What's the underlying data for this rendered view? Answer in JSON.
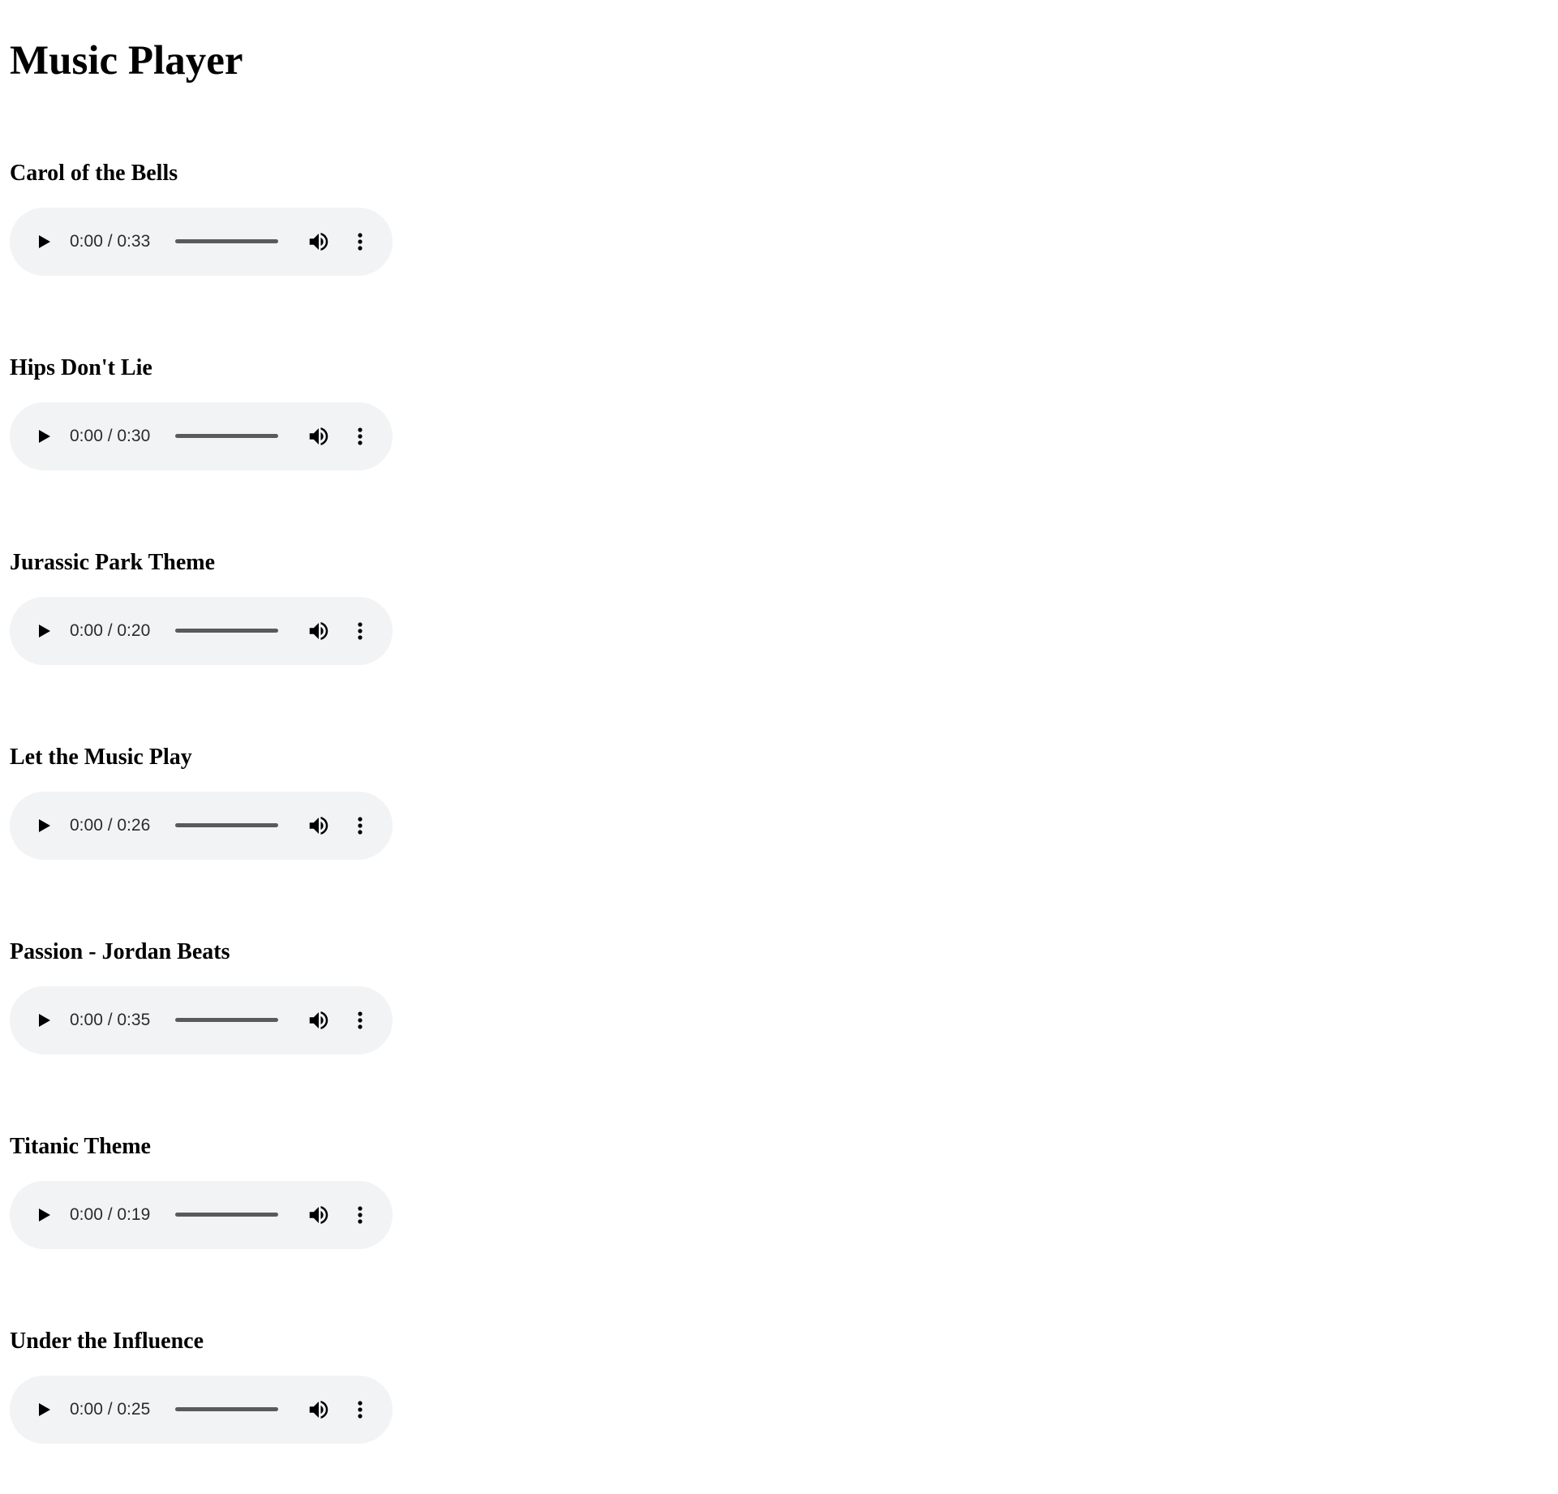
{
  "page": {
    "title": "Music Player"
  },
  "tracks": [
    {
      "title": "Carol of the Bells",
      "current_time": "0:00",
      "duration": "0:33",
      "time_display": "0:00 / 0:33",
      "progress": 0
    },
    {
      "title": "Hips Don't Lie",
      "current_time": "0:00",
      "duration": "0:30",
      "time_display": "0:00 / 0:30",
      "progress": 0
    },
    {
      "title": "Jurassic Park Theme",
      "current_time": "0:00",
      "duration": "0:20",
      "time_display": "0:00 / 0:20",
      "progress": 0
    },
    {
      "title": "Let the Music Play",
      "current_time": "0:00",
      "duration": "0:26",
      "time_display": "0:00 / 0:26",
      "progress": 0
    },
    {
      "title": "Passion - Jordan Beats",
      "current_time": "0:00",
      "duration": "0:35",
      "time_display": "0:00 / 0:35",
      "progress": 0
    },
    {
      "title": "Titanic Theme",
      "current_time": "0:00",
      "duration": "0:19",
      "time_display": "0:00 / 0:19",
      "progress": 0
    },
    {
      "title": "Under the Influence",
      "current_time": "0:00",
      "duration": "0:25",
      "time_display": "0:00 / 0:25",
      "progress": 0
    }
  ],
  "player_icons": {
    "play": "play-icon",
    "volume": "volume-icon",
    "menu": "more-vertical-icon"
  },
  "colors": {
    "player_background": "#f1f3f4",
    "control_foreground": "#000000",
    "progress_track": "#5a5a5a"
  }
}
